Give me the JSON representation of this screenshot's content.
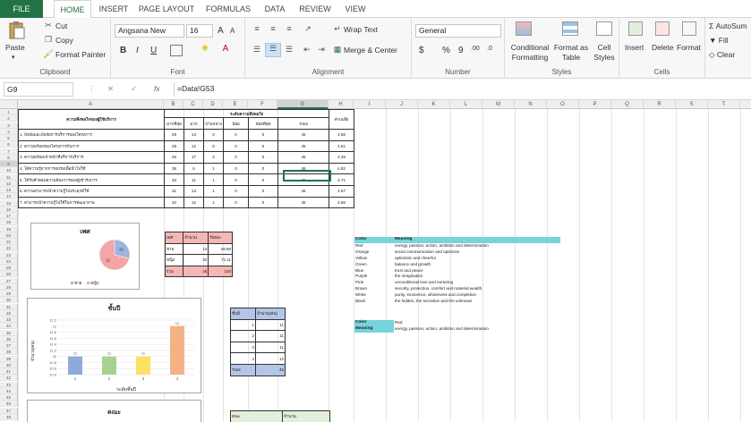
{
  "tabs": [
    "FILE",
    "HOME",
    "INSERT",
    "PAGE LAYOUT",
    "FORMULAS",
    "DATA",
    "REVIEW",
    "VIEW"
  ],
  "ribbon": {
    "clipboard": {
      "paste": "Paste",
      "cut": "Cut",
      "copy": "Copy",
      "format_painter": "Format Painter",
      "label": "Clipboard"
    },
    "font": {
      "name": "Angsana New",
      "size": "16",
      "grow": "A",
      "shrink": "A",
      "bold": "B",
      "italic": "I",
      "underline": "U",
      "label": "Font"
    },
    "alignment": {
      "wrap": "Wrap Text",
      "merge": "Merge & Center",
      "label": "Alignment"
    },
    "number": {
      "format": "General",
      "currency": "$",
      "percent": "%",
      "comma": "9",
      "inc_decimal": ".00",
      "dec_decimal": ".0",
      "label": "Number"
    },
    "styles": {
      "conditional": "Conditional",
      "conditional2": "Formatting",
      "format_as": "Format as",
      "format_as2": "Table",
      "cell_styles": "Cell",
      "cell_styles2": "Styles",
      "label": "Styles"
    },
    "cells": {
      "insert": "Insert",
      "delete": "Delete",
      "format": "Format",
      "label": "Cells"
    },
    "editing": {
      "autosum": "AutoSum",
      "fill": "Fill",
      "clear": "Clear"
    }
  },
  "formula_bar": {
    "name_box": "G9",
    "cancel": "✕",
    "enter": "✓",
    "fx": "fx",
    "formula": "=Data!G53"
  },
  "columns": [
    "A",
    "B",
    "C",
    "D",
    "E",
    "F",
    "G",
    "H",
    "I",
    "J",
    "K",
    "L",
    "M",
    "N",
    "O",
    "P",
    "Q",
    "R",
    "S",
    "T",
    "U",
    "V"
  ],
  "rows": [
    "1",
    "2",
    "3",
    "4",
    "5",
    "6",
    "7",
    "8",
    "9",
    "10",
    "11",
    "12",
    "13",
    "14",
    "15",
    "16",
    "17",
    "18",
    "19",
    "20",
    "21",
    "22",
    "23",
    "24",
    "25",
    "26",
    "27",
    "28",
    "29",
    "30",
    "31",
    "32",
    "33",
    "34",
    "35",
    "36",
    "37",
    "38",
    "39",
    "40",
    "41",
    "42",
    "43",
    "44",
    "45",
    "46",
    "47",
    "48"
  ],
  "table1": {
    "header_title": "ความพึงพอใจของผู้ใช้บริการ",
    "level_header": "ระดับความพึงพอใจ",
    "levels": [
      "มากที่สุด",
      "มาก",
      "ปานกลาง",
      "น้อย",
      "น้อยที่สุด",
      "Total",
      "ค่าเฉลี่ย"
    ],
    "rows": [
      {
        "item": "1. ปัจจัยและปัจจัยการบริการของโครงการ",
        "v": [
          "29",
          "13",
          "3",
          "0",
          "0",
          "45",
          "4.58"
        ]
      },
      {
        "item": "2. ความพร้อมของโครงการกับการ",
        "v": [
          "28",
          "12",
          "5",
          "0",
          "0",
          "45",
          "4.51"
        ]
      },
      {
        "item": "3. ความพร้อมเจ้าหน้าที่บริการบริการ",
        "v": [
          "25",
          "17",
          "3",
          "0",
          "0",
          "45",
          "4.49"
        ]
      },
      {
        "item": "4. ได้ความรู้จากการอบรมเพื่อนำไปใช้",
        "v": [
          "38",
          "6",
          "1",
          "0",
          "0",
          "45",
          "4.82"
        ]
      },
      {
        "item": "5. ได้รับคำตอบความต้องการของผู้เข้ารับการ",
        "v": [
          "33",
          "11",
          "1",
          "0",
          "0",
          "45",
          "4.71"
        ]
      },
      {
        "item": "6. ความสามารถนำความรู้ไปประยุกต์ใช้",
        "v": [
          "31",
          "13",
          "1",
          "0",
          "0",
          "45",
          "4.67"
        ]
      },
      {
        "item": "7. สามารถนำความรู้ไปใช้ในการพัฒนางาน",
        "v": [
          "32",
          "12",
          "1",
          "0",
          "0",
          "45",
          "4.69"
        ]
      }
    ]
  },
  "chart_data": [
    {
      "type": "pie",
      "title": "เพศ",
      "categories": [
        "ชาย",
        "หญิง"
      ],
      "values": [
        13,
        32
      ],
      "labels": [
        "13",
        "32"
      ],
      "colors": [
        "#9db4df",
        "#f4a6a6"
      ]
    },
    {
      "type": "bar",
      "title": "ชั้นปี",
      "xlabel": "ระดับชั้นปี",
      "ylabel": "จำนวน(คน)",
      "categories": [
        "1",
        "2",
        "3",
        "4"
      ],
      "values": [
        11,
        11,
        11,
        12
      ],
      "labels": [
        "11",
        "11",
        "11",
        "12"
      ],
      "ylim": [
        10.4,
        12.2
      ],
      "yticks": [
        "10.4",
        "10.6",
        "10.8",
        "11",
        "11.2",
        "11.4",
        "11.6",
        "11.8",
        "12",
        "12.2"
      ],
      "colors": [
        "#8eaadb",
        "#a9d18e",
        "#ffe066",
        "#f4b183"
      ]
    },
    {
      "type": "table",
      "title": "คณะ"
    }
  ],
  "table2": {
    "headers": [
      "เพศ",
      "จำนวน",
      "ร้อยละ"
    ],
    "rows": [
      [
        "ชาย",
        "13",
        "28.89"
      ],
      [
        "หญิง",
        "32",
        "71.11"
      ],
      [
        "รวม",
        "45",
        "100"
      ]
    ]
  },
  "table3": {
    "headers": [
      "ชั้นปี",
      "จำนวน(คน)"
    ],
    "rows": [
      [
        "1",
        "11"
      ],
      [
        "2",
        "11"
      ],
      [
        "3",
        "11"
      ],
      [
        "4",
        "12"
      ]
    ],
    "total_label": "Total",
    "total": "45"
  },
  "table4": {
    "headers": [
      "คณะ",
      "จำนวน"
    ]
  },
  "color_table": {
    "header": [
      "Color",
      "Meaning"
    ],
    "rows": [
      [
        "Red",
        "energy, passion, action, ambition and determination"
      ],
      [
        "Orange",
        "social communication and optimism"
      ],
      [
        "Yellow",
        "optimistic and cheerful"
      ],
      [
        "Green",
        "balance and growth"
      ],
      [
        "Blue",
        "trust and peace"
      ],
      [
        "Purple",
        "the imagination"
      ],
      [
        "Pink",
        "unconditional love and nurturing"
      ],
      [
        "Brown",
        "security, protection, comfort and material wealth"
      ],
      [
        "White",
        "purity, innocence, wholeness and completion"
      ],
      [
        "Black",
        "the hidden, the secretive and the unknown"
      ]
    ],
    "lookup_color_label": "Color",
    "lookup_color": "Red",
    "lookup_meaning_label": "Meaning",
    "lookup_meaning": "energy, passion, action, ambition and determination"
  },
  "colors": {
    "excel_green": "#217346",
    "header_fill": "#76d4dc",
    "pink_fill": "#f4b6b6",
    "blue_fill": "#b4c6e7"
  }
}
